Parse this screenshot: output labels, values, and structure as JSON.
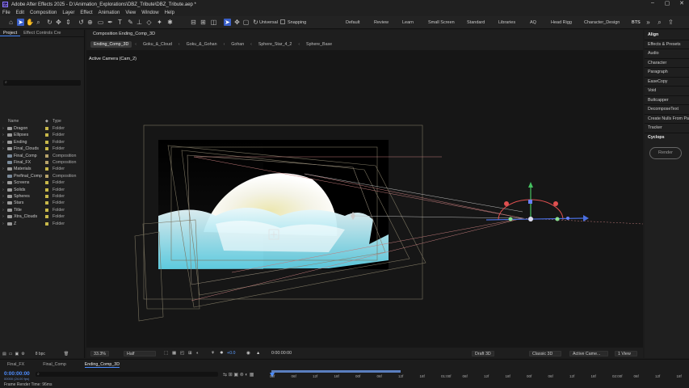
{
  "app": {
    "title": "Adobe After Effects 2025 - D:\\Animation_Explorations\\DBZ_Tribute\\DBZ_Tribute.aep *",
    "logo": "Ae"
  },
  "menu": [
    "File",
    "Edit",
    "Composition",
    "Layer",
    "Effect",
    "Animation",
    "View",
    "Window",
    "Help"
  ],
  "toolbar": {
    "universal": "Universal",
    "snapping": "Snapping",
    "workspaces": [
      "Default",
      "Review",
      "Learn",
      "Small Screen",
      "Standard",
      "Libraries",
      "AQ",
      "Head Rigg",
      "Character_Design",
      "BTS"
    ],
    "active_workspace": "BTS"
  },
  "project": {
    "tabs": [
      "Project",
      "Effect Controls Cre"
    ],
    "search_placeholder": "",
    "columns": {
      "name": "Name",
      "type": "Type"
    },
    "items": [
      {
        "name": "Dragon",
        "type": "Folder",
        "color": "#c8b84a",
        "kind": "folder"
      },
      {
        "name": "Ellipses",
        "type": "Folder",
        "color": "#c8b84a",
        "kind": "folder"
      },
      {
        "name": "Ending",
        "type": "Folder",
        "color": "#c8b84a",
        "kind": "folder"
      },
      {
        "name": "Final_Clouds",
        "type": "Folder",
        "color": "#c8b84a",
        "kind": "folder"
      },
      {
        "name": "Final_Comp",
        "type": "Composition",
        "color": "#b7a36b",
        "kind": "comp"
      },
      {
        "name": "Final_FX",
        "type": "Composition",
        "color": "#b7a36b",
        "kind": "comp"
      },
      {
        "name": "Materials",
        "type": "Folder",
        "color": "#c8b84a",
        "kind": "folder"
      },
      {
        "name": "Prefinal_Comp",
        "type": "Composition",
        "color": "#b7a36b",
        "kind": "comp"
      },
      {
        "name": "Screens",
        "type": "Folder",
        "color": "#c8b84a",
        "kind": "folder"
      },
      {
        "name": "Solids",
        "type": "Folder",
        "color": "#c8b84a",
        "kind": "folder"
      },
      {
        "name": "Spheres",
        "type": "Folder",
        "color": "#c8b84a",
        "kind": "folder"
      },
      {
        "name": "Stars",
        "type": "Folder",
        "color": "#c8b84a",
        "kind": "folder"
      },
      {
        "name": "Title",
        "type": "Folder",
        "color": "#c8b84a",
        "kind": "folder"
      },
      {
        "name": "Xtra_Clouds",
        "type": "Folder",
        "color": "#c8b84a",
        "kind": "folder"
      },
      {
        "name": "Z",
        "type": "Folder",
        "color": "#c8b84a",
        "kind": "folder"
      }
    ],
    "bpc": "8 bpc"
  },
  "comp": {
    "tab": "Composition Ending_Comp_3D",
    "breadcrumbs": [
      "Ending_Comp_3D",
      "Goku_&_Cloud",
      "Goku_&_Gohan",
      "Gohan",
      "Sphere_Star_4_2",
      "Sphere_Base"
    ],
    "camera_label": "Active Camera (Cam_2)",
    "footer": {
      "zoom": "33.3%",
      "resolution": "Half",
      "exposure": "+0.0",
      "timecode": "0:00:00:00",
      "renderer": "Draft 3D",
      "renderer2": "Classic 3D",
      "camera": "Active Came...",
      "views": "1 View"
    }
  },
  "right_panel": {
    "items": [
      "Align",
      "Effects & Presets",
      "Audio",
      "Character",
      "Paragraph",
      "EaseCopy",
      "Void",
      "Buttcapper",
      "DecomposeText",
      "Create Nulls From Pa",
      "Tracker",
      "Cyclops"
    ],
    "render": "Render"
  },
  "timeline": {
    "tabs": [
      "Final_FX",
      "Final_Comp",
      "Ending_Comp_3D"
    ],
    "timecode": "0:00:00:00",
    "fps": "00000 (24.00 fps)",
    "search_placeholder": "",
    "frame_render_time": "Frame Render Time: 96ms",
    "ticks": [
      "00f",
      "06f",
      "12f",
      "18f",
      "00f",
      "06f",
      "12f",
      "18f",
      "01:00f",
      "06f",
      "12f",
      "18f",
      "00f",
      "06f",
      "12f",
      "18f",
      "02:00f",
      "06f",
      "12f",
      "18f"
    ]
  }
}
